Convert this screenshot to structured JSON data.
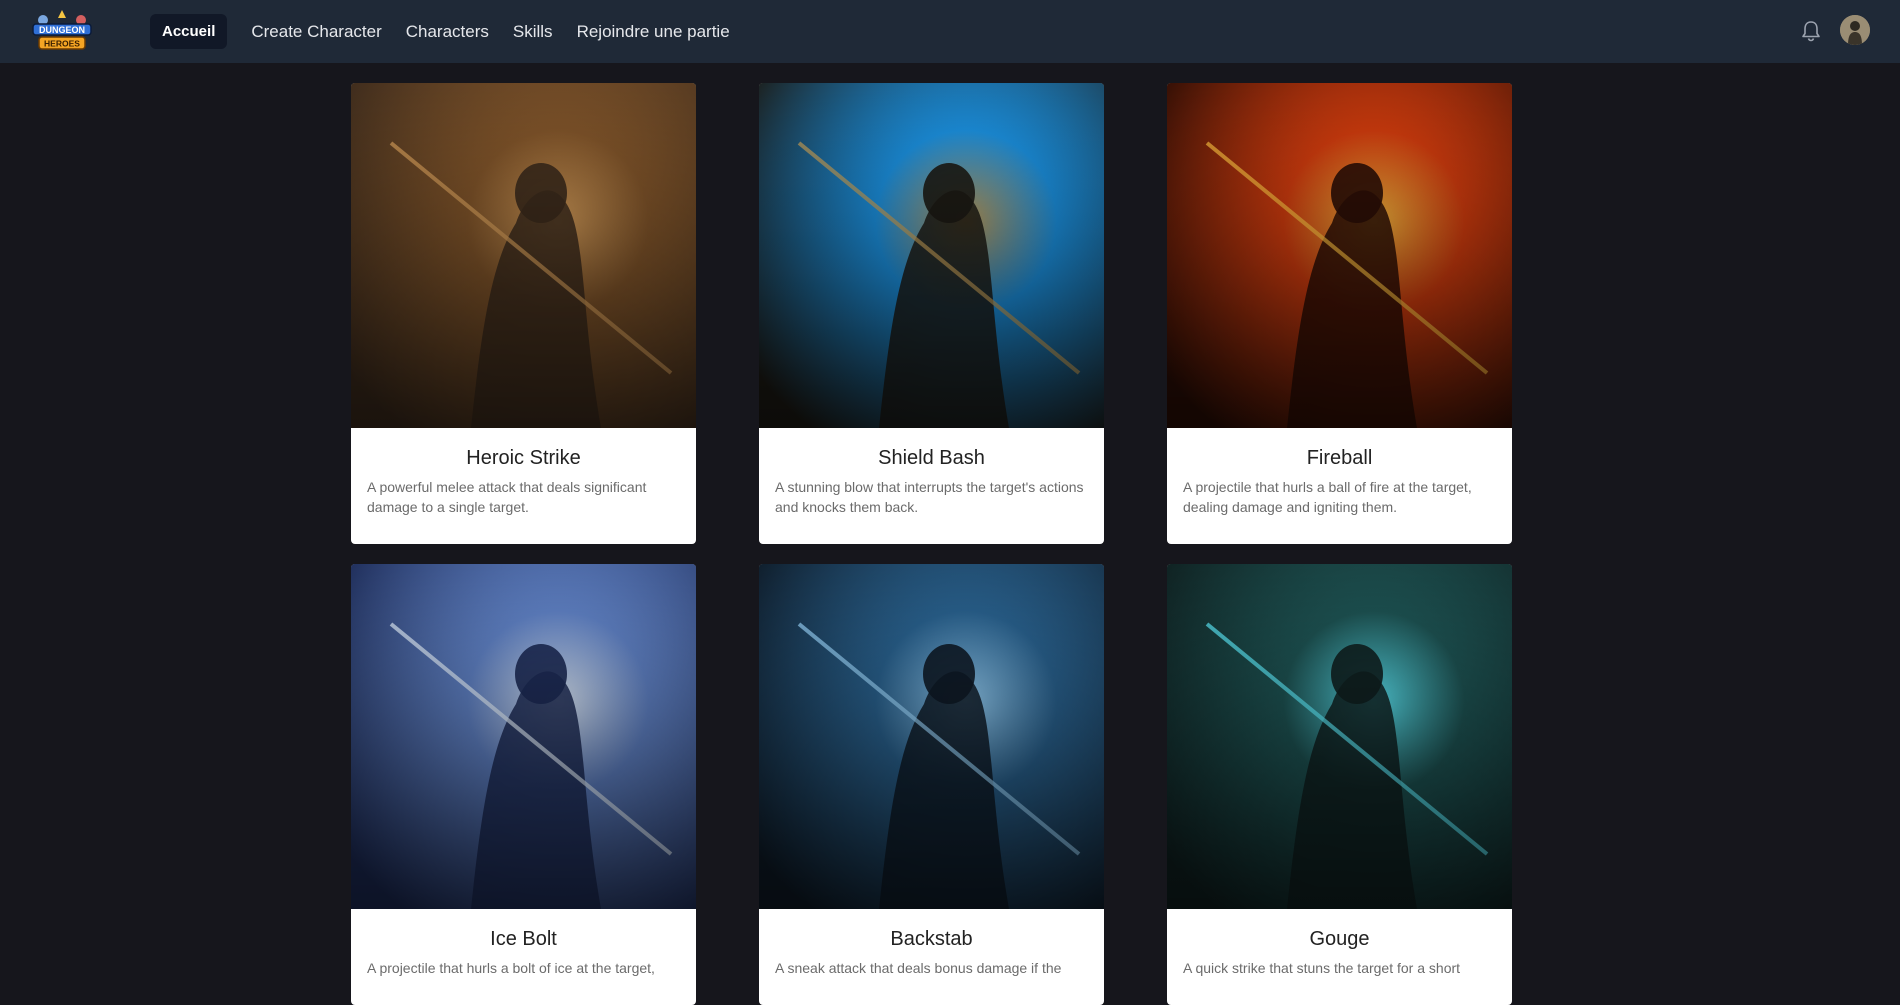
{
  "app": {
    "logo_text_top": "DUNGEON",
    "logo_text_bottom": "HEROES"
  },
  "nav": {
    "items": [
      {
        "label": "Accueil",
        "active": true
      },
      {
        "label": "Create Character",
        "active": false
      },
      {
        "label": "Characters",
        "active": false
      },
      {
        "label": "Skills",
        "active": false
      },
      {
        "label": "Rejoindre une partie",
        "active": false
      }
    ],
    "icons": [
      "bell-icon",
      "user-avatar"
    ]
  },
  "skills": [
    {
      "name": "Heroic Strike",
      "description": "A powerful melee attack that deals significant damage to a single target.",
      "art": "armored-warrior-sword-art",
      "colors": [
        "#3b2a1c",
        "#8a5a2b",
        "#d9a05b"
      ]
    },
    {
      "name": "Shield Bash",
      "description": "A stunning blow that interrupts the target's actions and knocks them back.",
      "art": "glowing-blue-shield-art",
      "colors": [
        "#1c1a14",
        "#1ba3ff",
        "#c8a25a"
      ]
    },
    {
      "name": "Fireball",
      "description": "A projectile that hurls a ball of fire at the target, dealing damage and igniting them.",
      "art": "fire-mage-art",
      "colors": [
        "#2a0d05",
        "#e8420f",
        "#ffc040"
      ]
    },
    {
      "name": "Ice Bolt",
      "description": "A projectile that hurls a bolt of ice at the target,",
      "art": "ice-mage-art",
      "colors": [
        "#1c2a55",
        "#6a8fd6",
        "#e6f2ff"
      ]
    },
    {
      "name": "Backstab",
      "description": "A sneak attack that deals bonus damage if the",
      "art": "hooded-rogue-dagger-art",
      "colors": [
        "#0e1a26",
        "#2d6c9e",
        "#9cd8ff"
      ]
    },
    {
      "name": "Gouge",
      "description": "A quick strike that stuns the target for a short",
      "art": "hooded-assassin-teal-art",
      "colors": [
        "#0f1f1f",
        "#1f5a5a",
        "#5ff0ff"
      ]
    }
  ]
}
